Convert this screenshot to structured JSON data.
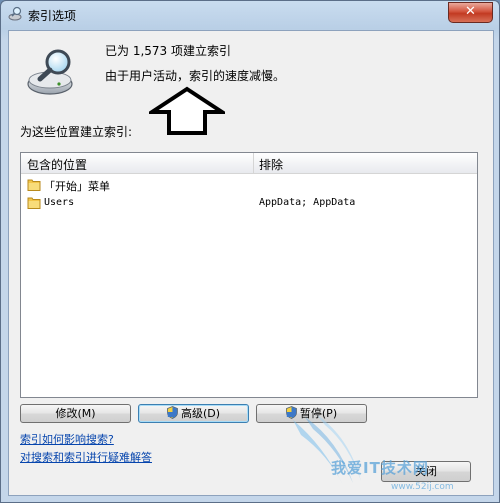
{
  "window": {
    "title": "索引选项",
    "close_glyph": "✕"
  },
  "header": {
    "count_text": "已为 1,573 项建立索引",
    "status_text": "由于用户活动，索引的速度减慢。",
    "icon": "magnifier-drive-icon"
  },
  "locations": {
    "label": "为这些位置建立索引:",
    "columns": [
      "包含的位置",
      "排除"
    ],
    "rows": [
      {
        "name": "「开始」菜单",
        "exclude": ""
      },
      {
        "name": "Users",
        "exclude": "AppData; AppData"
      }
    ]
  },
  "buttons": {
    "modify": "修改(M)",
    "advanced": "高级(D)",
    "pause": "暂停(P)",
    "close": "关闭"
  },
  "links": {
    "how_affects": "索引如何影响搜索?",
    "troubleshoot": "对搜索和索引进行疑难解答"
  },
  "watermark": {
    "text": "我爱IT技术网",
    "url": "www.52ij.com"
  },
  "colors": {
    "link": "#0645ad",
    "folder": "#f2c54a",
    "close_red": "#c23a22"
  }
}
